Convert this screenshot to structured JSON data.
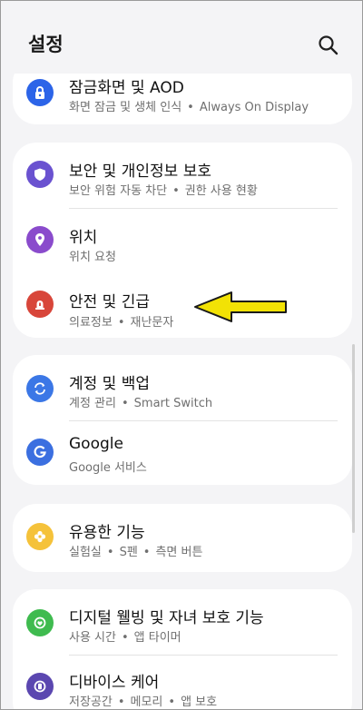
{
  "header": {
    "title": "설정"
  },
  "colors": {
    "background": "#f4f4f6",
    "lock": "#2c64e8",
    "security": "#6a52d0",
    "location": "#8a4bcc",
    "safety": "#d8463a",
    "accounts": "#3b77e6",
    "google": "#3b6fe0",
    "advanced": "#f5c23a",
    "wellbeing": "#3fbb4f",
    "devicecare": "#5b47b0",
    "arrow": "#f2e205"
  },
  "sections": [
    {
      "items": [
        {
          "title": "잠금화면 및 AOD",
          "subs": [
            "화면 잠금 및 생체 인식",
            "Always On Display"
          ],
          "icon": "lock-icon"
        }
      ]
    },
    {
      "items": [
        {
          "title": "보안 및 개인정보 보호",
          "subs": [
            "보안 위험 자동 차단",
            "권한 사용 현황"
          ],
          "icon": "shield-icon"
        },
        {
          "title": "위치",
          "subs": [
            "위치 요청"
          ],
          "icon": "location-pin-icon"
        },
        {
          "title": "안전 및 긴급",
          "subs": [
            "의료정보",
            "재난문자"
          ],
          "icon": "emergency-light-icon"
        }
      ]
    },
    {
      "items": [
        {
          "title": "계정 및 백업",
          "subs": [
            "계정 관리",
            "Smart Switch"
          ],
          "icon": "sync-icon"
        },
        {
          "title": "Google",
          "subs": [
            "Google 서비스"
          ],
          "icon": "google-icon"
        }
      ]
    },
    {
      "items": [
        {
          "title": "유용한 기능",
          "subs": [
            "실험실",
            "S펜",
            "측면 버튼"
          ],
          "icon": "puzzle-icon"
        }
      ]
    },
    {
      "items": [
        {
          "title": "디지털 웰빙 및 자녀 보호 기능",
          "subs": [
            "사용 시간",
            "앱 타이머"
          ],
          "icon": "wellbeing-icon"
        },
        {
          "title": "디바이스 케어",
          "subs": [
            "저장공간",
            "메모리",
            "앱 보호"
          ],
          "icon": "device-care-icon"
        }
      ]
    }
  ]
}
